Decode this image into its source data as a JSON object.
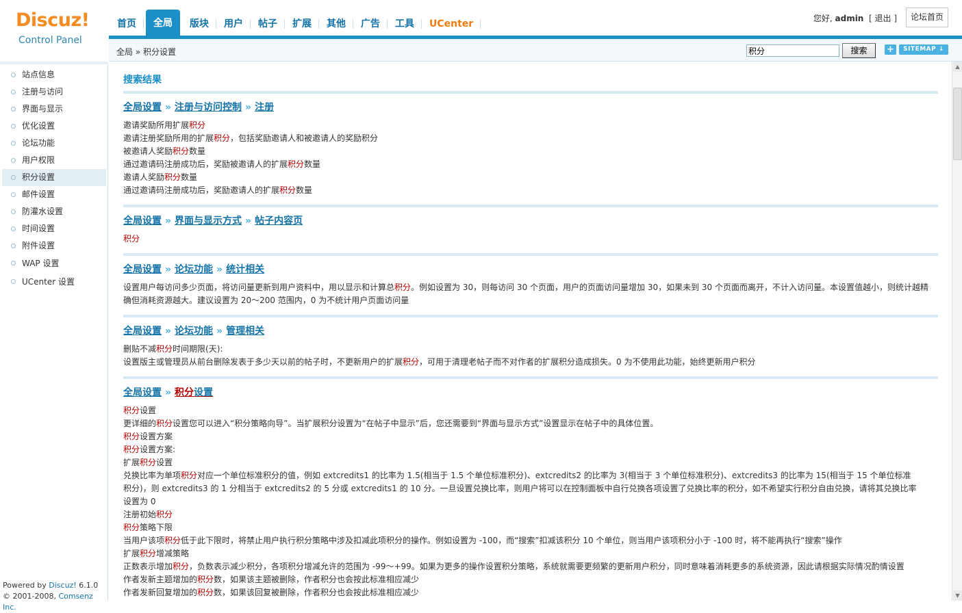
{
  "logo": {
    "brand": "Discuz!",
    "subtitle": "Control Panel"
  },
  "nav": {
    "tabs": [
      {
        "label": "首页"
      },
      {
        "label": "全局"
      },
      {
        "label": "版块"
      },
      {
        "label": "用户"
      },
      {
        "label": "帖子"
      },
      {
        "label": "扩展"
      },
      {
        "label": "其他"
      },
      {
        "label": "广告"
      },
      {
        "label": "工具"
      },
      {
        "label": "UCenter"
      }
    ],
    "active_tab": "全局"
  },
  "user": {
    "greeting": "您好, ",
    "name": "admin",
    "logout": "退出",
    "home_button": "论坛首页"
  },
  "breadcrumb": {
    "text": "全局 » 积分设置"
  },
  "search": {
    "value": "积分",
    "button": "搜索",
    "plus": "+",
    "sitemap": "SITEMAP ↓"
  },
  "sidebar": {
    "items": [
      {
        "label": "站点信息"
      },
      {
        "label": "注册与访问"
      },
      {
        "label": "界面与显示"
      },
      {
        "label": "优化设置"
      },
      {
        "label": "论坛功能"
      },
      {
        "label": "用户权限"
      },
      {
        "label": "积分设置"
      },
      {
        "label": "邮件设置"
      },
      {
        "label": "防灌水设置"
      },
      {
        "label": "时间设置"
      },
      {
        "label": "附件设置"
      },
      {
        "label": "WAP 设置"
      },
      {
        "label": "UCenter 设置"
      }
    ],
    "active": "积分设置",
    "footer": {
      "powered_prefix": "Powered by ",
      "powered_link": "Discuz!",
      "version": " 6.1.0",
      "copyright_prefix": "© 2001-2008, ",
      "copyright_link": "Comsenz Inc."
    }
  },
  "main": {
    "title": "搜索结果",
    "sections": [
      {
        "crumbs": [
          "全局设置",
          "注册与访问控制",
          "注册"
        ],
        "lines": [
          "邀请奖励所用扩展{积分}",
          "邀请注册奖励所用的扩展{积分}，包括奖励邀请人和被邀请人的奖励积分",
          "被邀请人奖励{积分}数量",
          "通过邀请码注册成功后，奖励被邀请人的扩展{积分}数量",
          "邀请人奖励{积分}数量",
          "通过邀请码注册成功后，奖励邀请人的扩展{积分}数量"
        ]
      },
      {
        "crumbs": [
          "全局设置",
          "界面与显示方式",
          "帖子内容页"
        ],
        "lines": [
          "{积分}"
        ]
      },
      {
        "crumbs": [
          "全局设置",
          "论坛功能",
          "统计相关"
        ],
        "lines": [
          "设置用户每访问多少页面，将访问量更新到用户资料中，用以显示和计算总{积分}。例如设置为 30，则每访问 30 个页面，用户的页面访问量增加 30，如果未到 30 个页面而离开，不计入访问量。本设置值越小，则统计越精",
          "确但消耗资源越大。建议设置为 20～200 范围内，0 为不统计用户页面访问量"
        ]
      },
      {
        "crumbs": [
          "全局设置",
          "论坛功能",
          "管理相关"
        ],
        "lines": [
          "删贴不减{积分}时间期限(天):",
          "设置版主或管理员从前台删除发表于多少天以前的帖子时，不更新用户的扩展{积分}，可用于清理老帖子而不对作者的扩展积分造成损失。0 为不使用此功能，始终更新用户积分"
        ]
      },
      {
        "crumbs": [
          "全局设置",
          "积分设置"
        ],
        "lines": [
          "{积分}设置",
          "更详细的{积分}设置您可以进入“积分策略向导”。当扩展积分设置为“在帖子中显示”后，您还需要到“界面与显示方式”设置显示在帖子中的具体位置。",
          "{积分}设置方案",
          "{积分}设置方案:",
          "扩展{积分}设置",
          "兑换比率为单项{积分}对应一个单位标准积分的值，例如 extcredits1 的比率为 1.5(相当于 1.5 个单位标准积分)、extcredits2 的比率为 3(相当于 3 个单位标准积分)、extcredits3 的比率为 15(相当于 15 个单位标准",
          "积分)，则 extcredits3 的 1 分相当于 extcredits2 的 5 分或 extcredits1 的 10 分。一旦设置兑换比率，则用户将可以在控制面板中自行兑换各项设置了兑换比率的积分，如不希望实行积分自由兑换，请将其兑换比率",
          "设置为 0",
          "注册初始{积分}",
          "{积分}策略下限",
          "当用户该项{积分}低于此下限时，将禁止用户执行积分策略中涉及扣减此项积分的操作。例如设置为 -100，而“搜索”扣减该积分 10 个单位，则当用户该项积分小于 -100 时，将不能再执行“搜索”操作",
          "扩展{积分}增减策略",
          "正数表示增加{积分}，负数表示减少积分，各项积分增减允许的范围为 -99～+99。如果为更多的操作设置积分策略，系统就需要更频繁的更新用户积分，同时意味着消耗更多的系统资源，因此请根据实际情况酌情设置",
          "作者发新主题增加的{积分}数，如果该主题被删除，作者积分也会按此标准相应减少",
          "作者发新回复增加的{积分}数，如果该回复被删除，作者积分也会按此标准相应减少"
        ]
      }
    ]
  },
  "colors": {
    "accent": "#1c8fc9",
    "link": "#1473a8",
    "highlight": "#b20000",
    "brand_orange": "#f28b20"
  }
}
